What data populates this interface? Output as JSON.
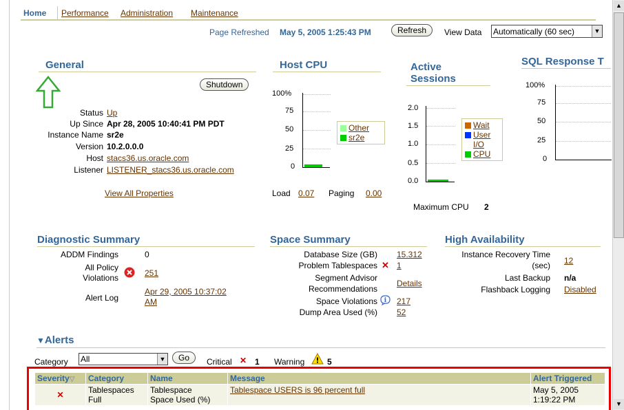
{
  "tabs": {
    "home": "Home",
    "performance": "Performance",
    "administration": "Administration",
    "maintenance": "Maintenance"
  },
  "refresh_bar": {
    "label": "Page Refreshed",
    "timestamp": "May 5, 2005 1:25:43 PM",
    "refresh_button": "Refresh",
    "view_data_label": "View Data",
    "view_data_value": "Automatically (60 sec)"
  },
  "general": {
    "title": "General",
    "shutdown_button": "Shutdown",
    "status_label": "Status",
    "status_value": "Up",
    "up_since_label": "Up Since",
    "up_since_value": "Apr 28, 2005 10:40:41 PM PDT",
    "instance_name_label": "Instance Name",
    "instance_name_value": "sr2e",
    "version_label": "Version",
    "version_value": "10.2.0.0.0",
    "host_label": "Host",
    "host_value": "stacs36.us.oracle.com",
    "listener_label": "Listener",
    "listener_value": "LISTENER_stacs36.us.oracle.com",
    "view_all": "View All Properties"
  },
  "host_cpu": {
    "title": "Host CPU",
    "ticks": [
      "100%",
      "75",
      "50",
      "25",
      "0"
    ],
    "legend": [
      {
        "label": "Other",
        "color": "#99ff99"
      },
      {
        "label": "sr2e",
        "color": "#00cc00"
      }
    ],
    "load_label": "Load",
    "load_value": "0.07",
    "paging_label": "Paging",
    "paging_value": "0.00"
  },
  "active_sessions": {
    "title_line1": "Active",
    "title_line2": "Sessions",
    "ticks": [
      "2.0",
      "1.5",
      "1.0",
      "0.5",
      "0.0"
    ],
    "legend": [
      {
        "label": "Wait",
        "color": "#cc6600"
      },
      {
        "label": "User",
        "color": "#0033ff"
      },
      {
        "label": "I/O",
        "color": ""
      },
      {
        "label": "CPU",
        "color": "#00cc00"
      }
    ],
    "max_cpu_label": "Maximum CPU",
    "max_cpu_value": "2"
  },
  "sql_response": {
    "title": "SQL Response T",
    "ticks": [
      "100%",
      "75",
      "50",
      "25",
      "0"
    ]
  },
  "diagnostic": {
    "title": "Diagnostic Summary",
    "addm_label": "ADDM Findings",
    "addm_value": "0",
    "policy_label_1": "All Policy",
    "policy_label_2": "Violations",
    "policy_value": "251",
    "alert_log_label": "Alert Log",
    "alert_log_value_1": "Apr 29, 2005 10:37:02",
    "alert_log_value_2": "AM"
  },
  "space": {
    "title": "Space Summary",
    "db_size_label": "Database Size (GB)",
    "db_size_value": "15.312",
    "problem_ts_label": "Problem Tablespaces",
    "problem_ts_value": "1",
    "segment_label_1": "Segment Advisor",
    "segment_label_2": "Recommendations",
    "segment_value": "Details",
    "space_viol_label": "Space Violations",
    "space_viol_value": "217",
    "dump_label": "Dump Area Used (%)",
    "dump_value": "52"
  },
  "ha": {
    "title": "High Availability",
    "recovery_label_1": "Instance Recovery Time",
    "recovery_label_2": "(sec)",
    "recovery_value": "12",
    "backup_label": "Last Backup",
    "backup_value": "n/a",
    "flashback_label": "Flashback Logging",
    "flashback_value": "Disabled"
  },
  "alerts": {
    "title": "Alerts",
    "category_label": "Category",
    "category_value": "All",
    "go_button": "Go",
    "critical_label": "Critical",
    "critical_count": "1",
    "warning_label": "Warning",
    "warning_count": "5",
    "columns": [
      "Severity",
      "Category",
      "Name",
      "Message",
      "Alert Triggered"
    ],
    "rows": [
      {
        "category_1": "Tablespaces",
        "category_2": "Full",
        "name_1": "Tablespace",
        "name_2": "Space Used (%)",
        "message": "Tablespace USERS is 96 percent full",
        "triggered_1": "May 5, 2005",
        "triggered_2": "1:19:22 PM"
      }
    ]
  },
  "colors": {
    "header_blue": "#336699",
    "link_brown": "#663300",
    "rule_tan": "#cccc99",
    "critical_red": "#cc0000",
    "highlight_red": "#ee0000"
  }
}
